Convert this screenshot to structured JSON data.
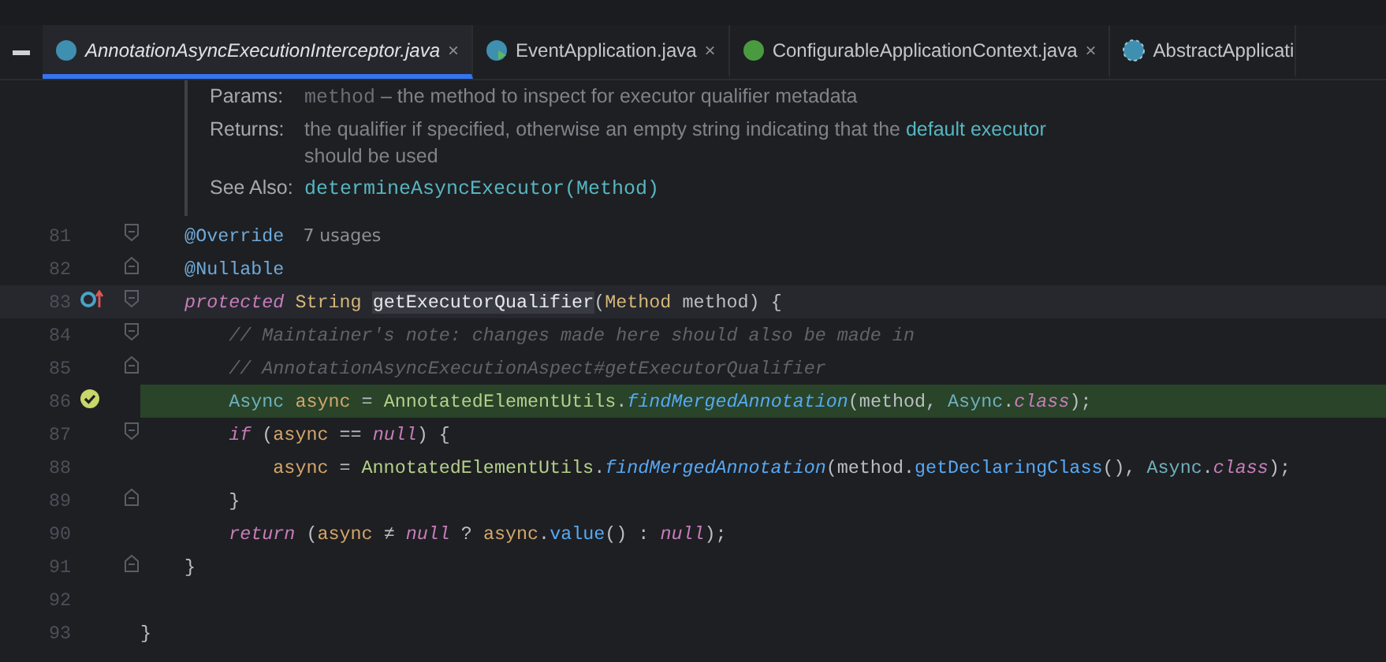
{
  "tabs": [
    {
      "label": "AnnotationAsyncExecutionInterceptor.java",
      "kind": "class",
      "selected": true,
      "close": "×"
    },
    {
      "label": "EventApplication.java",
      "kind": "runnable-class",
      "selected": false,
      "close": "×"
    },
    {
      "label": "ConfigurableApplicationContext.java",
      "kind": "interface",
      "selected": false,
      "close": "×"
    },
    {
      "label": "AbstractApplicati",
      "kind": "abstract-class",
      "selected": false
    }
  ],
  "doc": [
    {
      "label": "Params:",
      "lines": [
        [
          {
            "kind": "code",
            "text": "method"
          },
          {
            "kind": "text",
            "text": " – the method to inspect for executor qualifier metadata"
          }
        ]
      ]
    },
    {
      "label": "Returns:",
      "lines": [
        [
          {
            "kind": "text",
            "text": "the qualifier if specified, otherwise an empty string indicating that the "
          },
          {
            "kind": "link",
            "text": "default executor"
          }
        ],
        [
          {
            "kind": "text",
            "text": "should be used"
          }
        ]
      ]
    },
    {
      "label": "See Also:",
      "lines": [
        [
          {
            "kind": "code-link",
            "text": "determineAsyncExecutor(Method)"
          }
        ]
      ]
    }
  ],
  "lines": [
    {
      "number": "81",
      "fold_start": true,
      "fold_end": false,
      "overrides": false,
      "passed": false,
      "current": false,
      "highlighted": false,
      "tokens": [
        {
          "kind": "annotation",
          "text": "    @Override"
        },
        {
          "kind": "hint",
          "text": "7 usages"
        }
      ]
    },
    {
      "number": "82",
      "fold_start": false,
      "fold_end": true,
      "overrides": false,
      "passed": false,
      "current": false,
      "highlighted": false,
      "tokens": [
        {
          "kind": "annotation",
          "text": "    @Nullable"
        }
      ]
    },
    {
      "number": "83",
      "fold_start": true,
      "fold_end": false,
      "overrides": true,
      "passed": false,
      "current": true,
      "highlighted": false,
      "tokens": [
        {
          "kind": "keyword",
          "text": "    protected "
        },
        {
          "kind": "type",
          "text": "String "
        },
        {
          "kind": "declaration",
          "text": "getExecutorQualifier"
        },
        {
          "kind": "plain",
          "text": "("
        },
        {
          "kind": "type",
          "text": "Method "
        },
        {
          "kind": "plain",
          "text": "method) {"
        }
      ]
    },
    {
      "number": "84",
      "fold_start": true,
      "fold_end": false,
      "overrides": false,
      "passed": false,
      "current": false,
      "highlighted": false,
      "tokens": [
        {
          "kind": "comment",
          "text": "        // Maintainer's note: changes made here should also be made in"
        }
      ]
    },
    {
      "number": "85",
      "fold_start": false,
      "fold_end": true,
      "overrides": false,
      "passed": false,
      "current": false,
      "highlighted": false,
      "tokens": [
        {
          "kind": "comment",
          "text": "        // AnnotationAsyncExecutionAspect#getExecutorQualifier"
        }
      ]
    },
    {
      "number": "86",
      "fold_start": false,
      "fold_end": false,
      "overrides": false,
      "passed": true,
      "current": false,
      "highlighted": true,
      "tokens": [
        {
          "kind": "class-ref",
          "text": "        Async "
        },
        {
          "kind": "variable",
          "text": "async"
        },
        {
          "kind": "plain",
          "text": " = "
        },
        {
          "kind": "utility",
          "text": "AnnotatedElementUtils"
        },
        {
          "kind": "plain",
          "text": "."
        },
        {
          "kind": "static-call",
          "text": "findMergedAnnotation"
        },
        {
          "kind": "plain",
          "text": "(method, "
        },
        {
          "kind": "class-ref",
          "text": "Async"
        },
        {
          "kind": "plain",
          "text": "."
        },
        {
          "kind": "keyword",
          "text": "class"
        },
        {
          "kind": "plain",
          "text": ");"
        }
      ]
    },
    {
      "number": "87",
      "fold_start": true,
      "fold_end": false,
      "overrides": false,
      "passed": false,
      "current": false,
      "highlighted": false,
      "tokens": [
        {
          "kind": "keyword",
          "text": "        if"
        },
        {
          "kind": "plain",
          "text": " ("
        },
        {
          "kind": "variable",
          "text": "async"
        },
        {
          "kind": "plain",
          "text": " == "
        },
        {
          "kind": "keyword",
          "text": "null"
        },
        {
          "kind": "plain",
          "text": ") {"
        }
      ]
    },
    {
      "number": "88",
      "fold_start": false,
      "fold_end": false,
      "overrides": false,
      "passed": false,
      "current": false,
      "highlighted": false,
      "tokens": [
        {
          "kind": "variable",
          "text": "            async"
        },
        {
          "kind": "plain",
          "text": " = "
        },
        {
          "kind": "utility",
          "text": "AnnotatedElementUtils"
        },
        {
          "kind": "plain",
          "text": "."
        },
        {
          "kind": "static-call",
          "text": "findMergedAnnotation"
        },
        {
          "kind": "plain",
          "text": "(method."
        },
        {
          "kind": "method",
          "text": "getDeclaringClass"
        },
        {
          "kind": "plain",
          "text": "(), "
        },
        {
          "kind": "class-ref",
          "text": "Async"
        },
        {
          "kind": "plain",
          "text": "."
        },
        {
          "kind": "keyword",
          "text": "class"
        },
        {
          "kind": "plain",
          "text": ");"
        }
      ]
    },
    {
      "number": "89",
      "fold_start": false,
      "fold_end": true,
      "overrides": false,
      "passed": false,
      "current": false,
      "highlighted": false,
      "tokens": [
        {
          "kind": "plain",
          "text": "        }"
        }
      ]
    },
    {
      "number": "90",
      "fold_start": false,
      "fold_end": false,
      "overrides": false,
      "passed": false,
      "current": false,
      "highlighted": false,
      "tokens": [
        {
          "kind": "keyword",
          "text": "        return"
        },
        {
          "kind": "plain",
          "text": " ("
        },
        {
          "kind": "variable",
          "text": "async"
        },
        {
          "kind": "plain",
          "text": " ≠ "
        },
        {
          "kind": "keyword",
          "text": "null"
        },
        {
          "kind": "plain",
          "text": " ? "
        },
        {
          "kind": "variable",
          "text": "async"
        },
        {
          "kind": "plain",
          "text": "."
        },
        {
          "kind": "method",
          "text": "value"
        },
        {
          "kind": "plain",
          "text": "() : "
        },
        {
          "kind": "keyword",
          "text": "null"
        },
        {
          "kind": "plain",
          "text": ");"
        }
      ]
    },
    {
      "number": "91",
      "fold_start": false,
      "fold_end": true,
      "overrides": false,
      "passed": false,
      "current": false,
      "highlighted": false,
      "tokens": [
        {
          "kind": "plain",
          "text": "    }"
        }
      ]
    },
    {
      "number": "92",
      "fold_start": false,
      "fold_end": false,
      "overrides": false,
      "passed": false,
      "current": false,
      "highlighted": false
    },
    {
      "number": "93",
      "fold_start": false,
      "fold_end": false,
      "overrides": false,
      "passed": false,
      "current": false,
      "highlighted": false,
      "tokens": [
        {
          "kind": "plain",
          "text": "}"
        }
      ]
    }
  ]
}
